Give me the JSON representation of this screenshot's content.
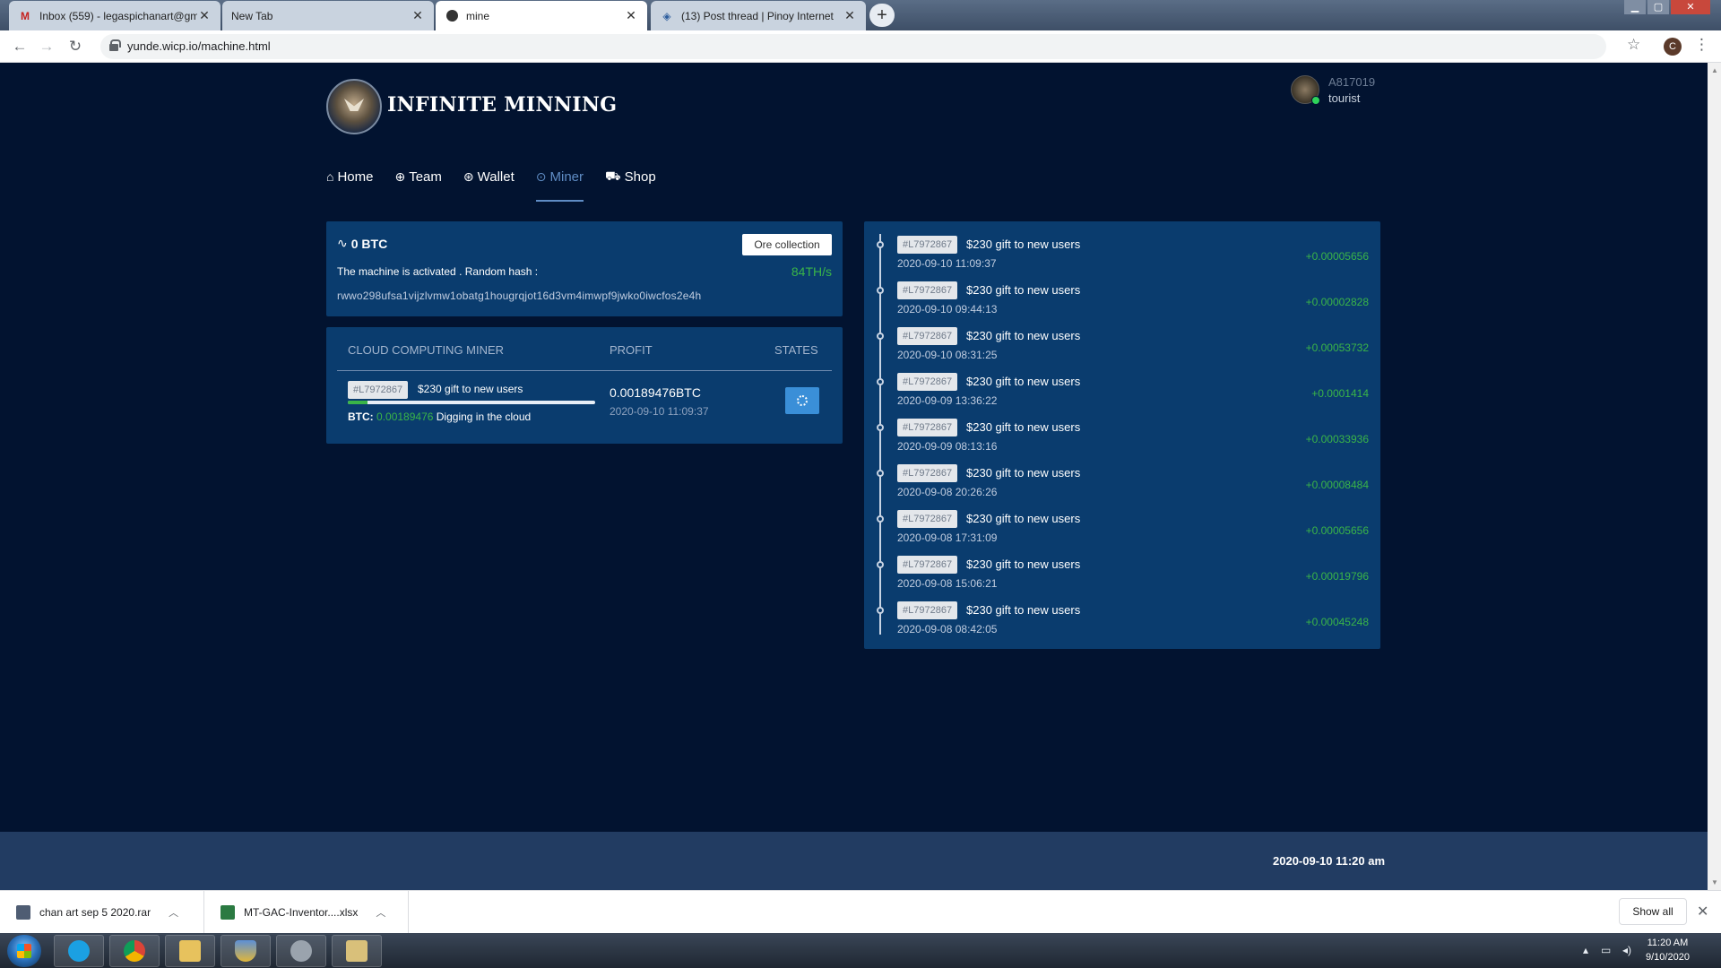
{
  "browser": {
    "tabs": [
      {
        "title": "Inbox (559) - legaspichanart@gm",
        "icon": "gmail-icon",
        "active": false
      },
      {
        "title": "New Tab",
        "icon": "",
        "active": false
      },
      {
        "title": "mine",
        "icon": "site-icon",
        "active": true
      },
      {
        "title": "(13) Post thread | Pinoy Internet",
        "icon": "forum-icon",
        "active": false
      }
    ],
    "url": "yunde.wicp.io/machine.html",
    "profile_initial": "C"
  },
  "site": {
    "brand": "INFINITE MINNING",
    "user": {
      "id": "A817019",
      "role": "tourist"
    },
    "nav": [
      {
        "label": "Home",
        "icon": "home-icon",
        "active": false
      },
      {
        "label": "Team",
        "icon": "globe-icon",
        "active": false
      },
      {
        "label": "Wallet",
        "icon": "wallet-icon",
        "active": false
      },
      {
        "label": "Miner",
        "icon": "miner-icon",
        "active": true
      },
      {
        "label": "Shop",
        "icon": "cart-icon",
        "active": false
      }
    ]
  },
  "status": {
    "balance": "0 BTC",
    "ore_button": "Ore collection",
    "activated_text": "The machine is activated . Random hash :",
    "hashrate": "84TH/s",
    "hash": "rwwo298ufsa1vijzlvmw1obatg1hougrqjot16d3vm4imwpf9jwko0iwcfos2e4h"
  },
  "miner": {
    "headers": {
      "miner": "CLOUD COMPUTING MINER",
      "profit": "PROFIT",
      "states": "STATES"
    },
    "tag": "#L7972867",
    "description": "$230 gift to new users",
    "progress": 0.08,
    "btc_label": "BTC:",
    "btc_value": "0.00189476",
    "btc_status": "Digging in the cloud",
    "profit": "0.00189476BTC",
    "profit_date": "2020-09-10 11:09:37"
  },
  "log": [
    {
      "tag": "#L7972867",
      "title": "$230 gift to new users",
      "date": "2020-09-10 11:09:37",
      "amount": "+0.00005656"
    },
    {
      "tag": "#L7972867",
      "title": "$230 gift to new users",
      "date": "2020-09-10 09:44:13",
      "amount": "+0.00002828"
    },
    {
      "tag": "#L7972867",
      "title": "$230 gift to new users",
      "date": "2020-09-10 08:31:25",
      "amount": "+0.00053732"
    },
    {
      "tag": "#L7972867",
      "title": "$230 gift to new users",
      "date": "2020-09-09 13:36:22",
      "amount": "+0.0001414"
    },
    {
      "tag": "#L7972867",
      "title": "$230 gift to new users",
      "date": "2020-09-09 08:13:16",
      "amount": "+0.00033936"
    },
    {
      "tag": "#L7972867",
      "title": "$230 gift to new users",
      "date": "2020-09-08 20:26:26",
      "amount": "+0.00008484"
    },
    {
      "tag": "#L7972867",
      "title": "$230 gift to new users",
      "date": "2020-09-08 17:31:09",
      "amount": "+0.00005656"
    },
    {
      "tag": "#L7972867",
      "title": "$230 gift to new users",
      "date": "2020-09-08 15:06:21",
      "amount": "+0.00019796"
    },
    {
      "tag": "#L7972867",
      "title": "$230 gift to new users",
      "date": "2020-09-08 08:42:05",
      "amount": "+0.00045248"
    }
  ],
  "footer": {
    "time": "2020-09-10 11:20 am"
  },
  "downloads": {
    "items": [
      {
        "name": "chan art sep 5 2020.rar",
        "icon": "archive-icon"
      },
      {
        "name": "MT-GAC-Inventor....xlsx",
        "icon": "excel-icon"
      }
    ],
    "show_all": "Show all"
  },
  "taskbar": {
    "apps": [
      "skype-icon",
      "chrome-icon",
      "explorer-folder-icon",
      "security-shield-icon",
      "settings-gear-icon",
      "file-manager-icon"
    ],
    "clock_time": "11:20 AM",
    "clock_date": "9/10/2020"
  },
  "colors": {
    "page_bg": "#021330",
    "card_bg": "#0a3c6e",
    "accent_green": "#3ab548",
    "active_nav": "#5f8cc4"
  }
}
